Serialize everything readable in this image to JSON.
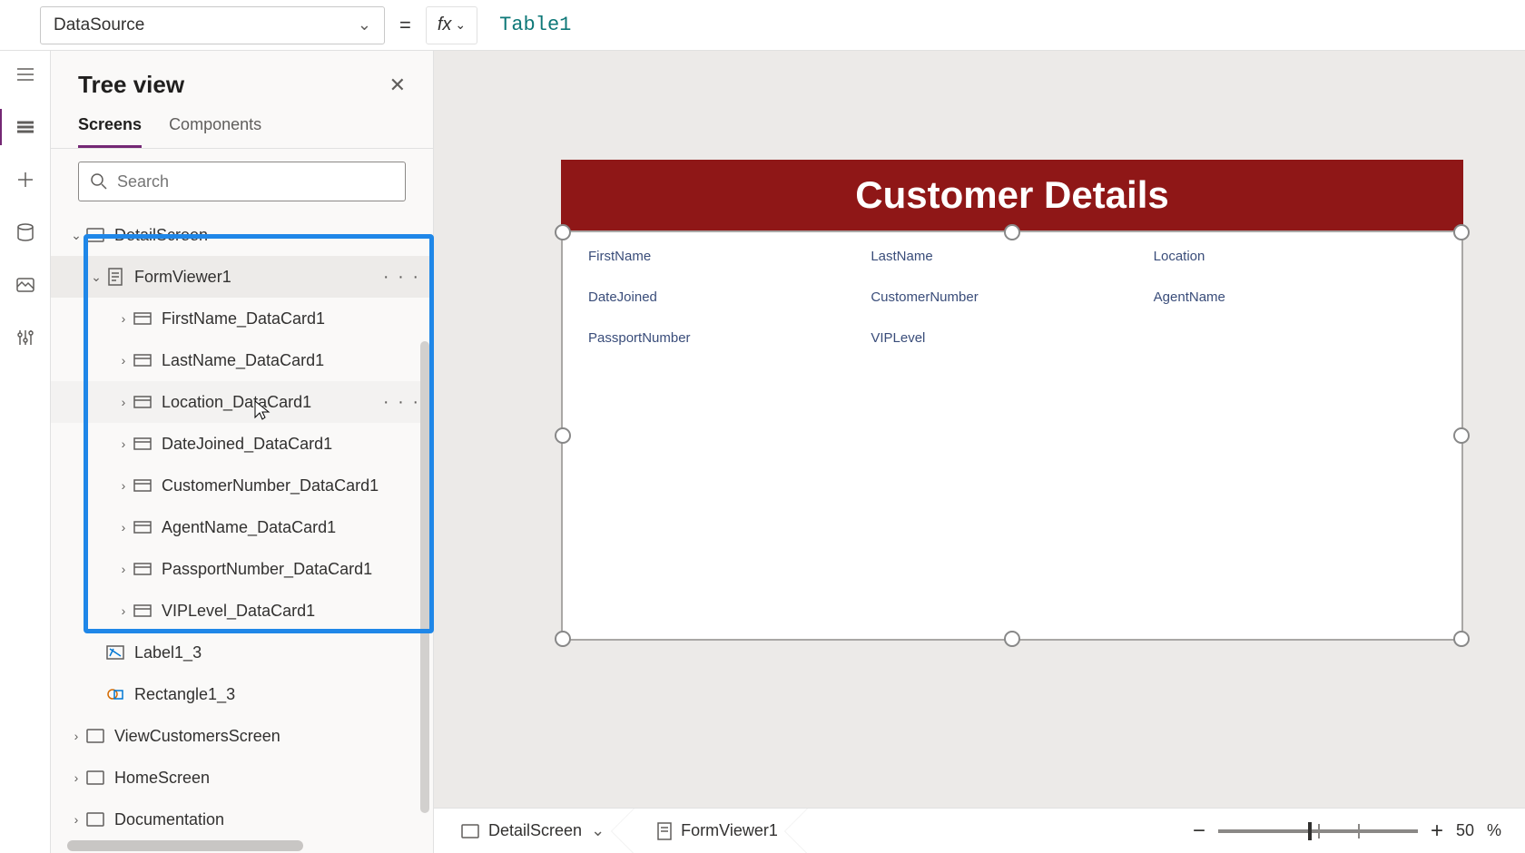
{
  "formula_bar": {
    "property": "DataSource",
    "equals": "=",
    "fx": "fx",
    "value": "Table1"
  },
  "panel": {
    "title": "Tree view",
    "tabs": {
      "screens": "Screens",
      "components": "Components"
    },
    "search_placeholder": "Search"
  },
  "tree": {
    "screen": "DetailScreen",
    "form": "FormViewer1",
    "cards": [
      "FirstName_DataCard1",
      "LastName_DataCard1",
      "Location_DataCard1",
      "DateJoined_DataCard1",
      "CustomerNumber_DataCard1",
      "AgentName_DataCard1",
      "PassportNumber_DataCard1",
      "VIPLevel_DataCard1"
    ],
    "label": "Label1_3",
    "rect": "Rectangle1_3",
    "other_screens": [
      "ViewCustomersScreen",
      "HomeScreen",
      "Documentation"
    ]
  },
  "canvas": {
    "title": "Customer Details",
    "fields": [
      "FirstName",
      "LastName",
      "Location",
      "DateJoined",
      "CustomerNumber",
      "AgentName",
      "PassportNumber",
      "VIPLevel"
    ]
  },
  "breadcrumb": {
    "screen": "DetailScreen",
    "control": "FormViewer1"
  },
  "zoom": {
    "value": "50",
    "pct": "%"
  },
  "glyphs": {
    "minus": "−",
    "plus": "+",
    "chev_down": "⌄",
    "more": "· · ·"
  }
}
